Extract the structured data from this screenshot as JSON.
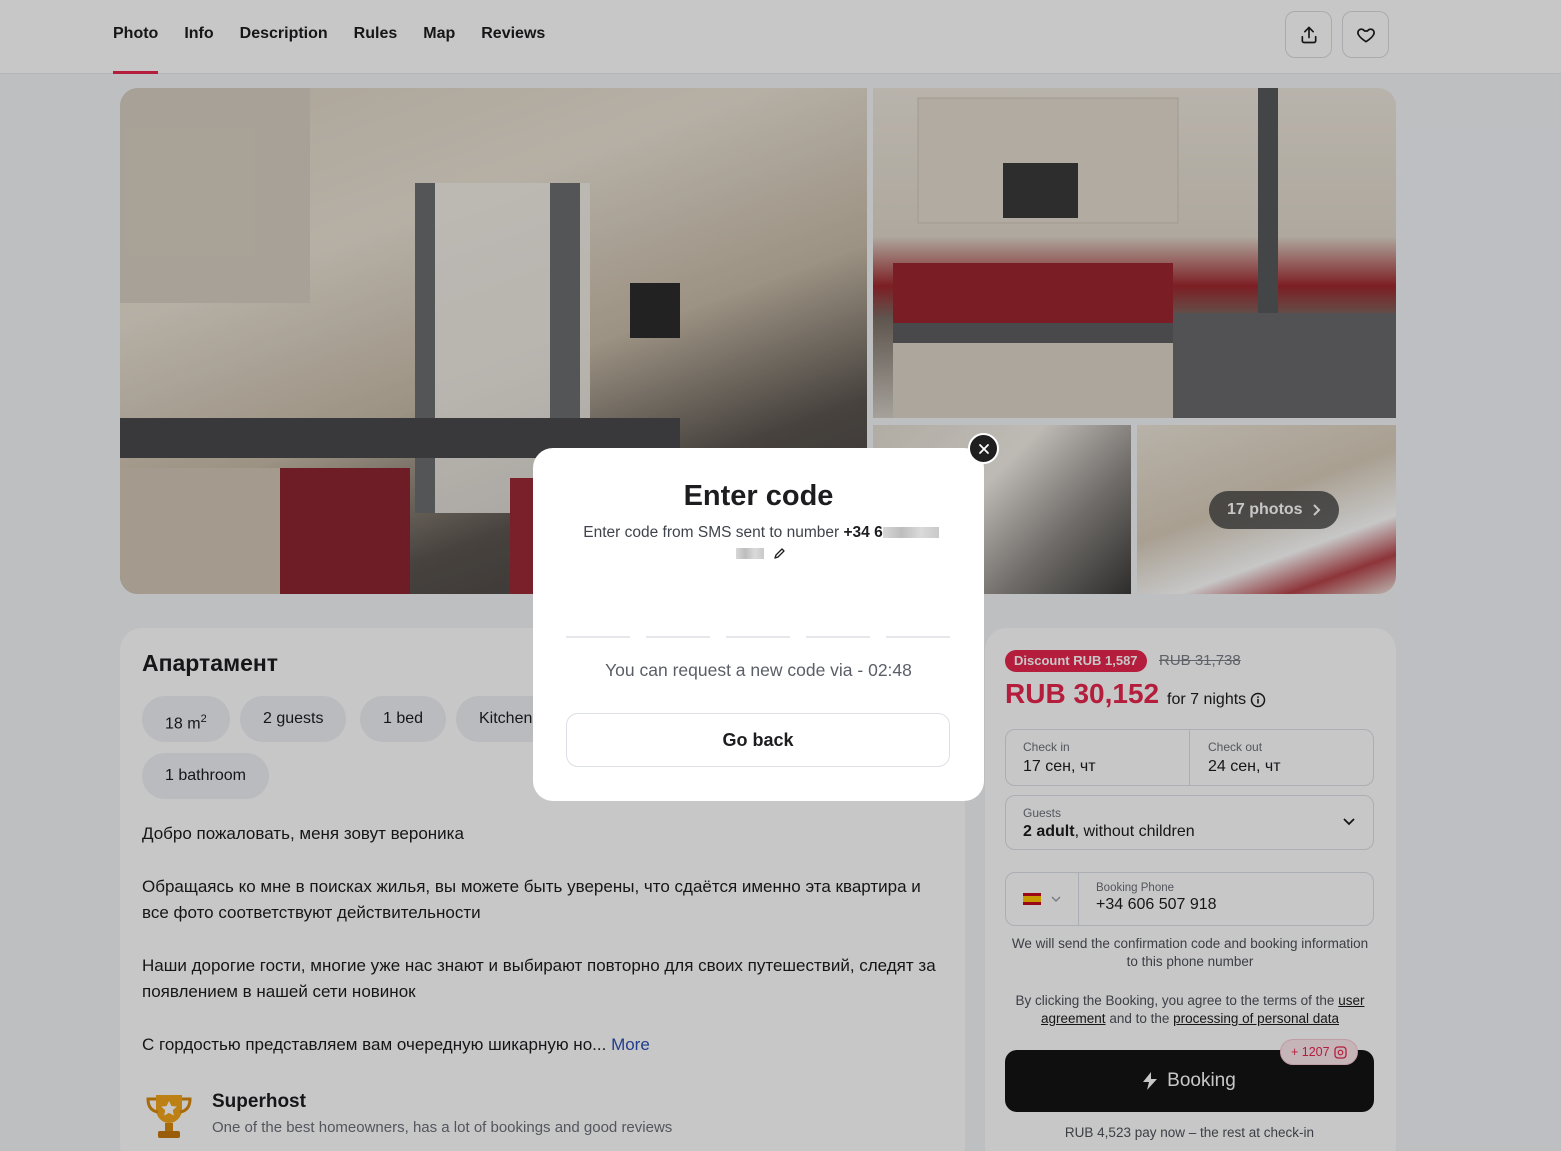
{
  "nav": {
    "tabs": [
      "Photo",
      "Info",
      "Description",
      "Rules",
      "Map",
      "Reviews"
    ],
    "active_tab": "Photo"
  },
  "gallery": {
    "photos_pill": "17 photos"
  },
  "listing": {
    "title": "Апартамент",
    "area_value": "18 m",
    "area_sup": "2",
    "chips": [
      "2 guests",
      "1 bed",
      "Kitchen",
      "1 bathroom"
    ],
    "paragraphs": [
      "Добро пожаловать, меня зовут вероника",
      "Обращаясь ко мне в поисках жилья, вы можете быть уверены, что сдаётся именно эта квартира и все фото соответствуют действительности",
      "Наши дорогие гости, многие уже нас знают и выбирают повторно для своих путешествий, следят за появлением в нашей сети новинок",
      "С гордостью представляем вам очередную шикарную но..."
    ],
    "more_link": "More",
    "superhost_title": "Superhost",
    "superhost_sub": "One of the best homeowners, has a lot of bookings and good reviews"
  },
  "booking": {
    "discount_badge": "Discount RUB 1,587",
    "old_price": "RUB 31,738",
    "price": "RUB 30,152",
    "nights": "for 7 nights",
    "checkin_label": "Check in",
    "checkin_value": "17 сен, чт",
    "checkout_label": "Check out",
    "checkout_value": "24 сен, чт",
    "guests_label": "Guests",
    "guests_bold": "2 adult",
    "guests_rest": ", without children",
    "phone_label": "Booking Phone",
    "phone_value": "+34 606 507 918",
    "sms_note": "We will send the confirmation code and booking information to this phone number",
    "terms_prefix": "By clicking the Booking, you agree to the terms of the",
    "terms_link1": "user agreement",
    "terms_mid": "and to the",
    "terms_link2": "processing of personal data",
    "bonus": "+ 1207",
    "book_label": "Booking",
    "pay_now": "RUB 4,523 pay now – the rest at check-in"
  },
  "modal": {
    "title": "Enter code",
    "subtitle": "Enter code from SMS sent to number",
    "phone_prefix": "+34 6",
    "timer": "You can request a new code via - 02:48",
    "back_label": "Go back"
  },
  "colors": {
    "accent": "#e8264e",
    "link": "#2b4fb5",
    "dark_button": "#141414"
  }
}
